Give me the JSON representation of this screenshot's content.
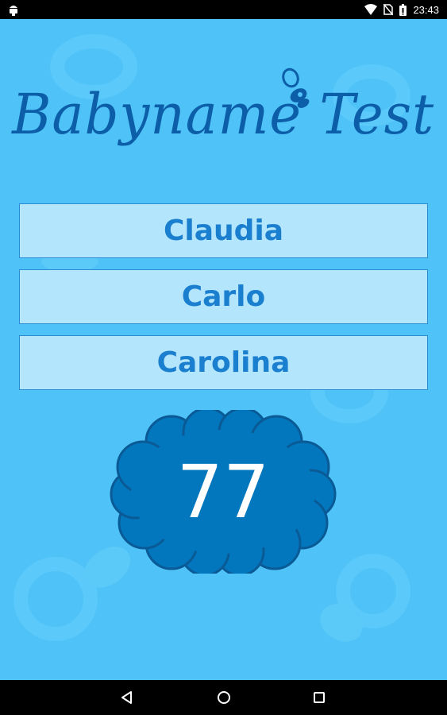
{
  "status_bar": {
    "time": "23:43",
    "icons": [
      "android-debug-icon",
      "wifi-icon",
      "no-sim-icon",
      "battery-icon"
    ]
  },
  "app": {
    "logo_text": "Babyname Test",
    "background_color": "#4fc3f7",
    "choices": [
      {
        "label": "Claudia"
      },
      {
        "label": "Carlo"
      },
      {
        "label": "Carolina"
      }
    ],
    "score": "77",
    "cloud_color": "#0277bd"
  },
  "nav_bar": {
    "buttons": [
      "back-icon",
      "home-icon",
      "recents-icon"
    ]
  }
}
